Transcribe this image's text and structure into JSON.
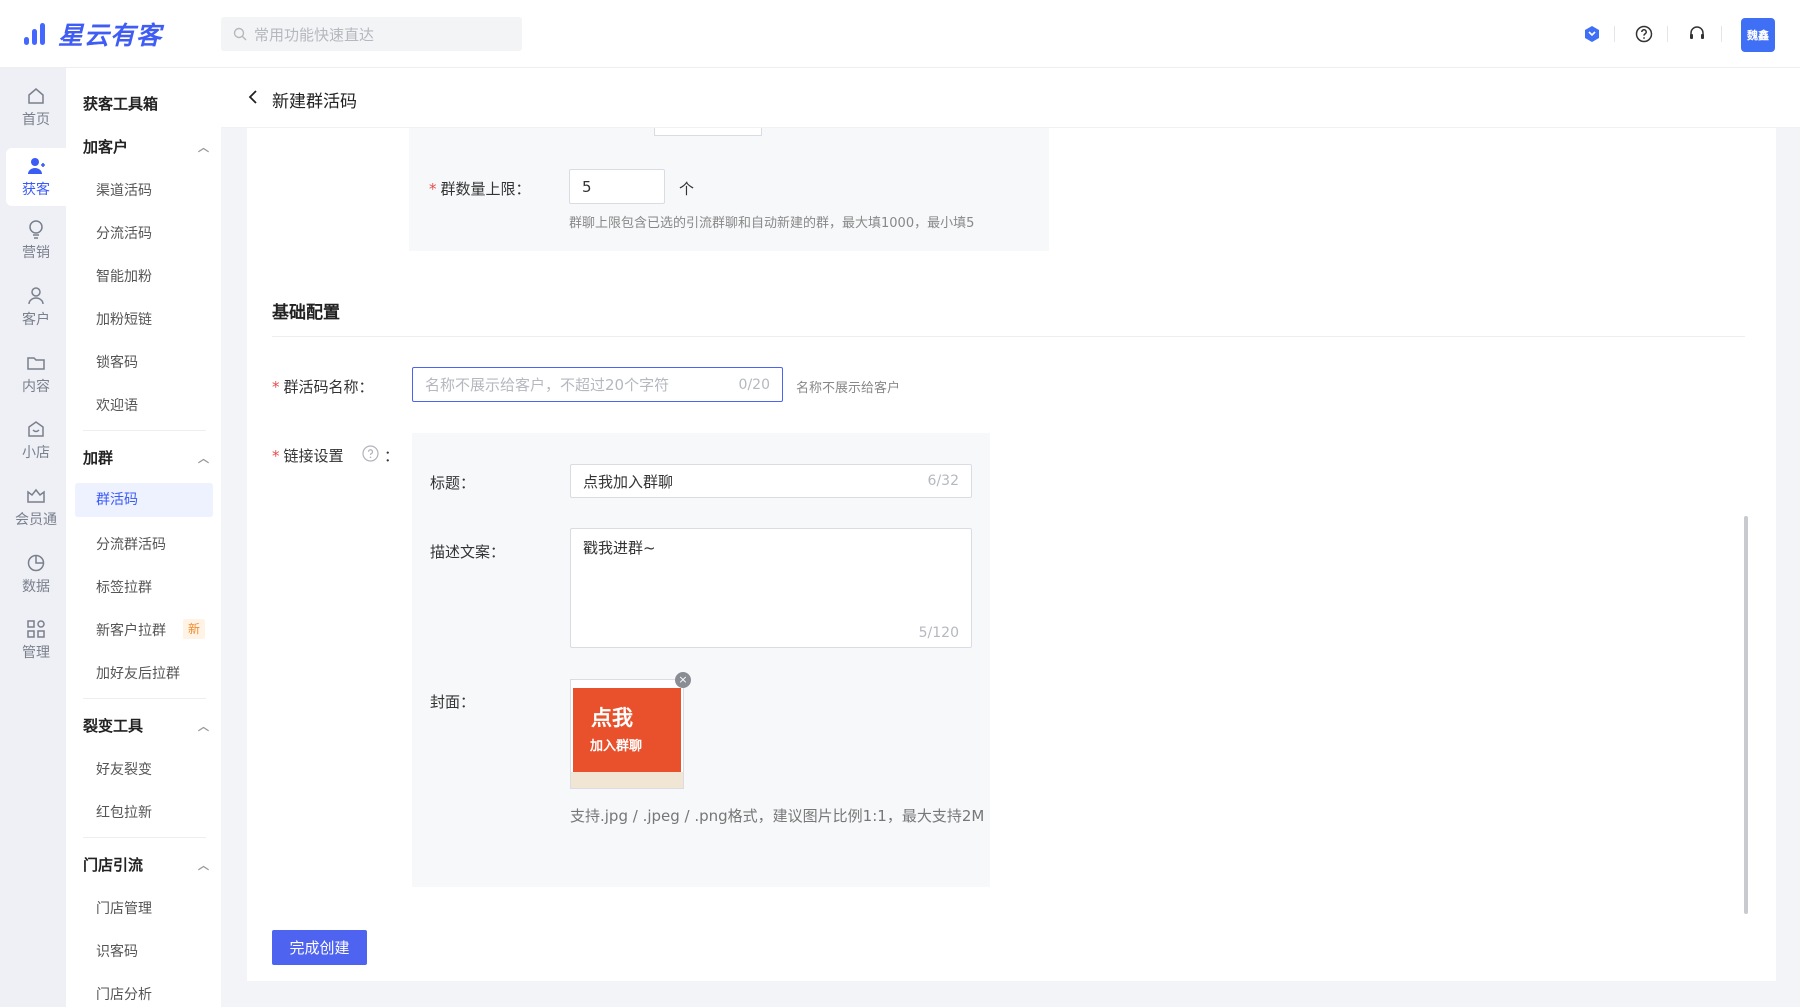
{
  "app": {
    "brand": "星云有客",
    "search_placeholder": "常用功能快速直达",
    "avatar_text": "魏鑫",
    "brand_color": "#3f5cf5",
    "top_icons": [
      "shield-icon",
      "help-circle-icon",
      "headset-icon"
    ]
  },
  "rail": {
    "items": [
      {
        "label": "首页",
        "icon": "home-icon"
      },
      {
        "label": "获客",
        "icon": "user-add-icon",
        "active": true
      },
      {
        "label": "营销",
        "icon": "bulb-icon"
      },
      {
        "label": "客户",
        "icon": "user-icon"
      },
      {
        "label": "内容",
        "icon": "folder-icon"
      },
      {
        "label": "小店",
        "icon": "shop-icon"
      },
      {
        "label": "会员通",
        "icon": "crown-icon"
      },
      {
        "label": "数据",
        "icon": "pie-chart-icon"
      },
      {
        "label": "管理",
        "icon": "apps-icon"
      }
    ]
  },
  "subnav": {
    "title": "获客工具箱",
    "groups": [
      {
        "label": "加客户",
        "items": [
          "渠道活码",
          "分流活码",
          "智能加粉",
          "加粉短链",
          "锁客码",
          "欢迎语"
        ]
      },
      {
        "label": "加群",
        "items": [
          "群活码",
          "分流群活码",
          "标签拉群",
          "新客户拉群",
          "加好友后拉群"
        ]
      },
      {
        "label": "裂变工具",
        "items": [
          "好友裂变",
          "红包拉新"
        ]
      },
      {
        "label": "门店引流",
        "items": [
          "门店管理",
          "识客码",
          "门店分析"
        ]
      }
    ],
    "new_badge": "新"
  },
  "page": {
    "title": "新建群活码",
    "group_limit": {
      "label": "群数量上限：",
      "value": "5",
      "unit": "个",
      "hint": "群聊上限包含已选的引流群聊和自动新建的群，最大填1000，最小填5"
    },
    "basic_section": "基础配置",
    "name_field": {
      "label": "群活码名称：",
      "placeholder": "名称不展示给客户，不超过20个字符",
      "counter": "0/20",
      "hint": "名称不展示给客户"
    },
    "link": {
      "label": "链接设置",
      "colon": "：",
      "title_label": "标题：",
      "title_value": "点我加入群聊",
      "title_counter": "6/32",
      "desc_label": "描述文案：",
      "desc_value": "戳我进群~",
      "desc_counter": "5/120",
      "cover_label": "封面：",
      "cover_text_1": "点我",
      "cover_text_2": "加入群聊",
      "cover_hint": "支持.jpg / .jpeg / .png格式，建议图片比例1:1，最大支持2M"
    },
    "submit_label": "完成创建",
    "required_mark": "*"
  }
}
